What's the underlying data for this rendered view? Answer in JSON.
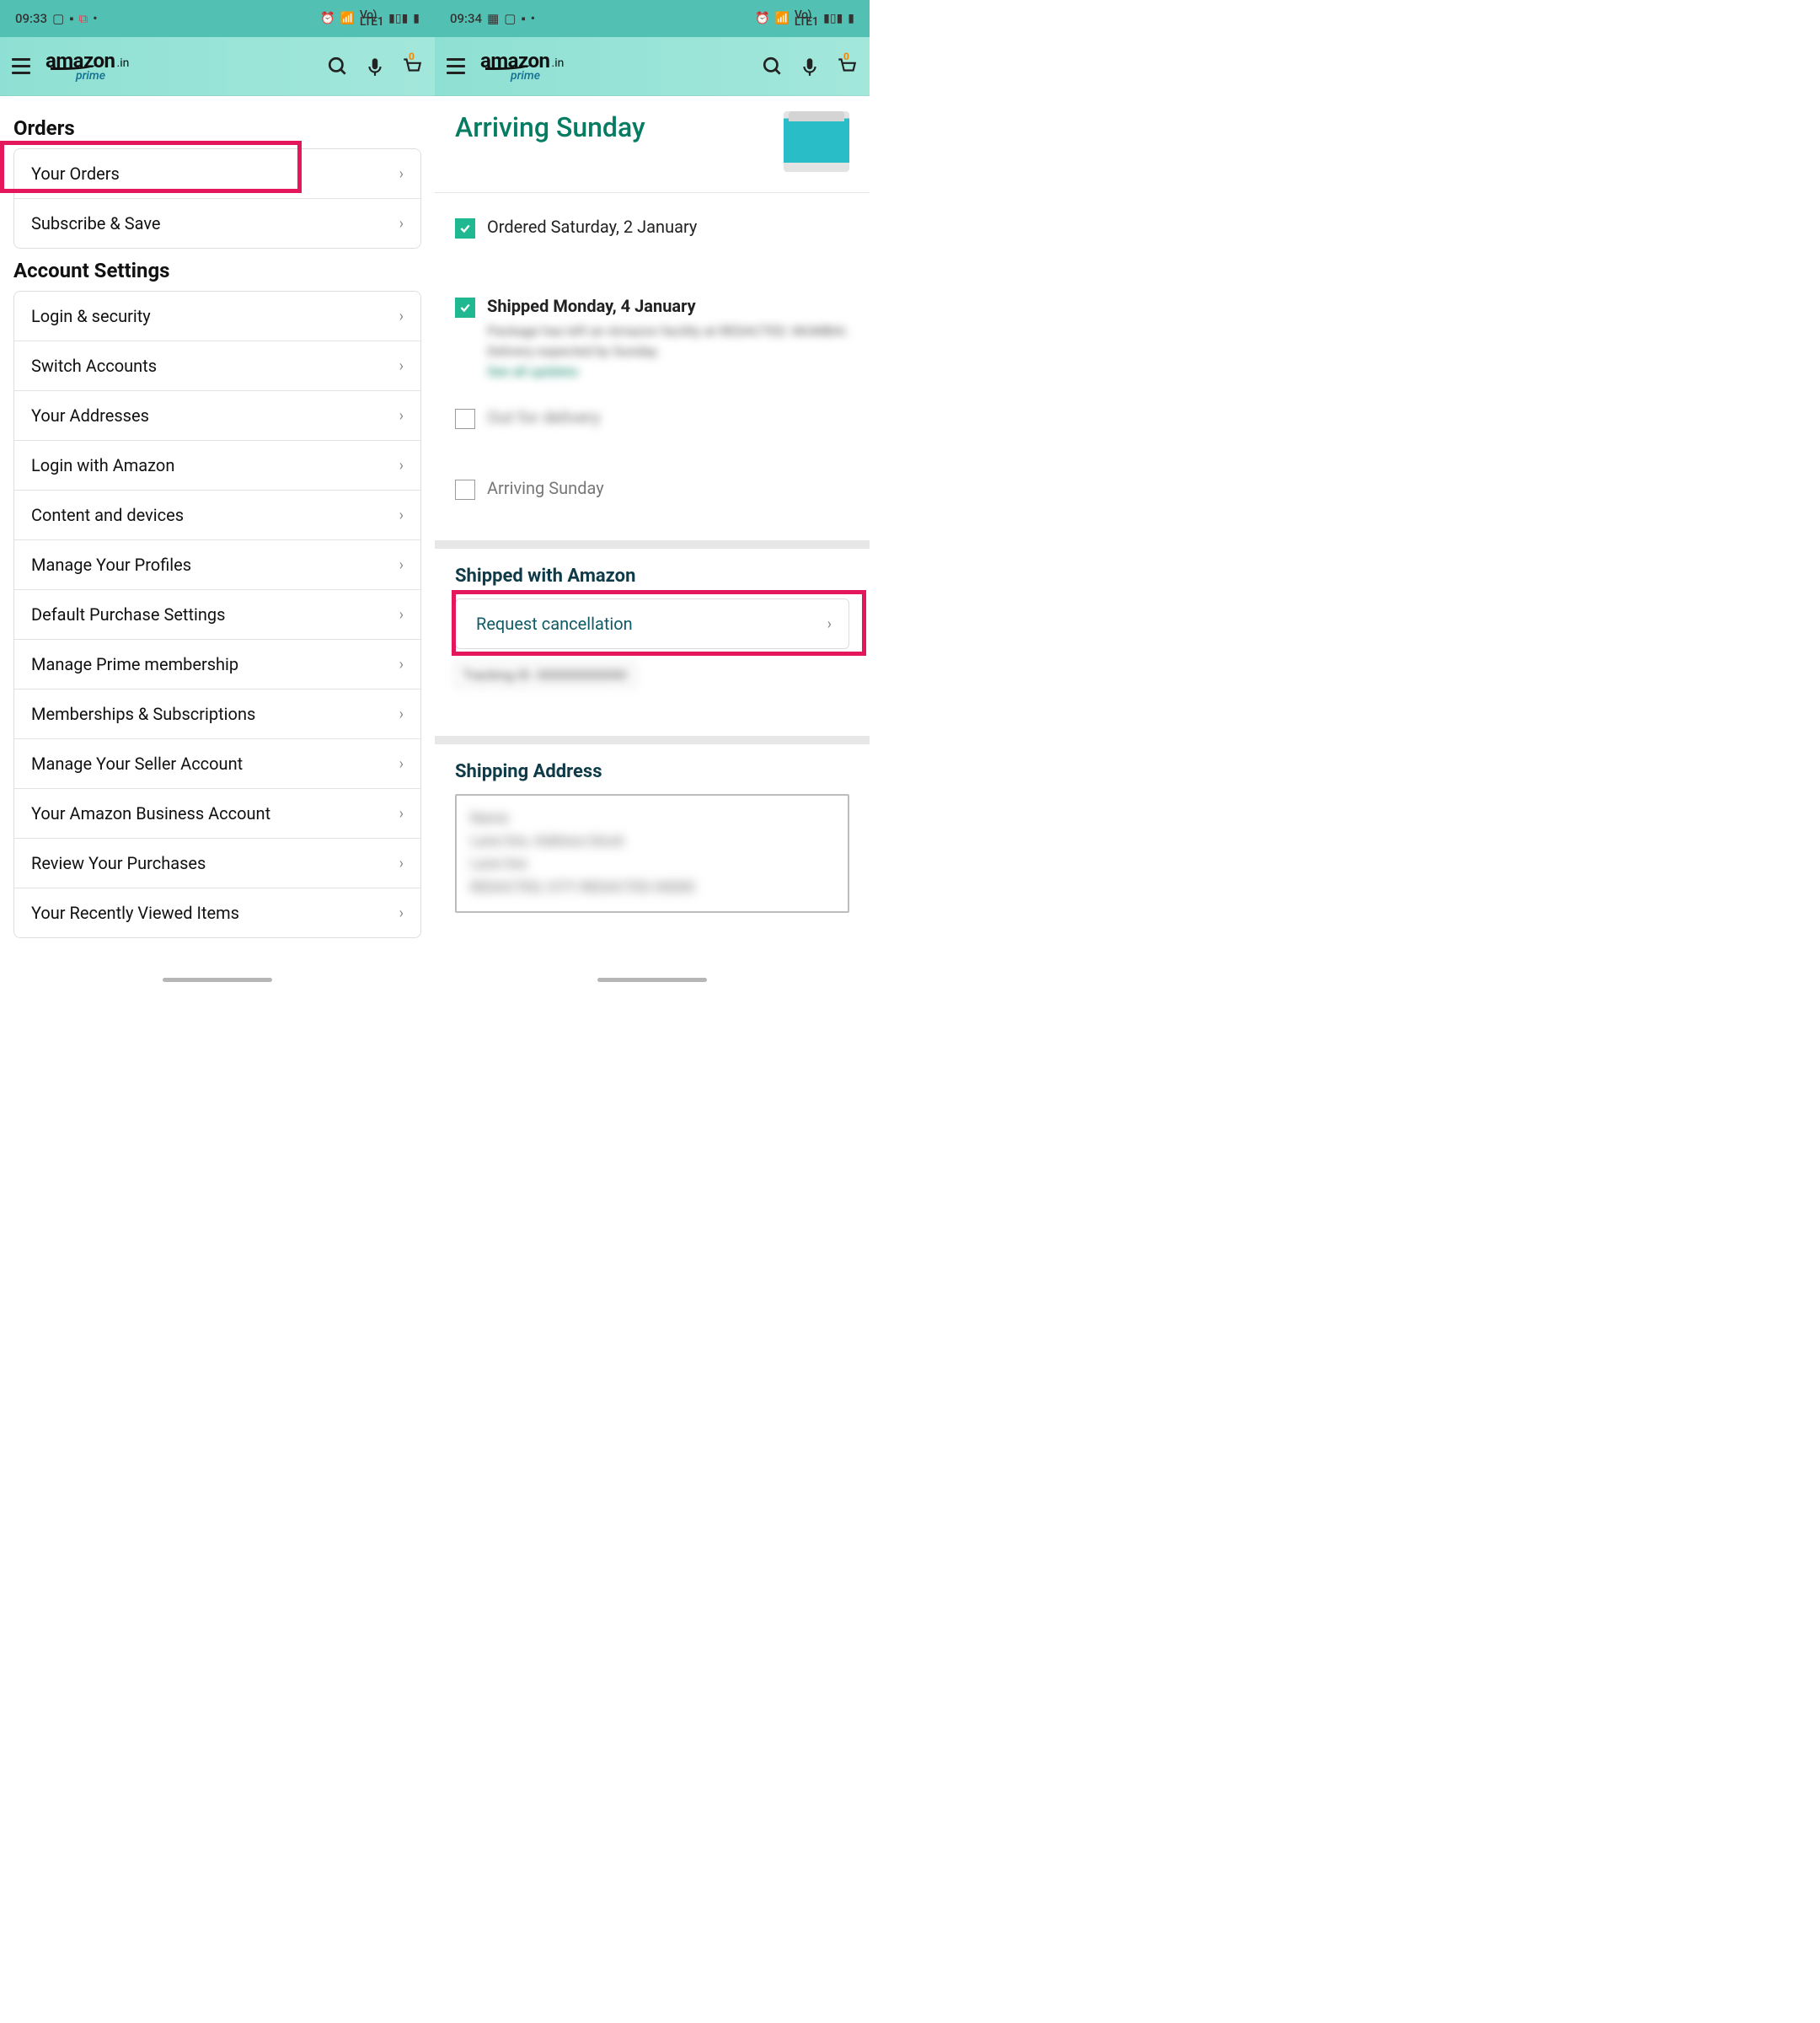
{
  "left": {
    "time": "09:33",
    "status_icons": [
      "image-icon",
      "bag-icon",
      "misc-icon",
      "dot"
    ],
    "right_icons": [
      "alarm",
      "wifi",
      "volte",
      "signal",
      "battery"
    ],
    "brand": {
      "name": "amazon",
      "domain": ".in",
      "sub": "prime"
    },
    "cart_count": "0",
    "sections": {
      "orders": {
        "title": "Orders",
        "items": [
          "Your Orders",
          "Subscribe & Save"
        ]
      },
      "account": {
        "title": "Account Settings",
        "items": [
          "Login & security",
          "Switch Accounts",
          "Your Addresses",
          "Login with Amazon",
          "Content and devices",
          "Manage Your Profiles",
          "Default Purchase Settings",
          "Manage Prime membership",
          "Memberships & Subscriptions",
          "Manage Your Seller Account",
          "Your Amazon Business Account",
          "Review Your Purchases",
          "Your Recently Viewed Items"
        ]
      }
    }
  },
  "right": {
    "time": "09:34",
    "status_icons": [
      "grid-icon",
      "image-icon",
      "bag-icon",
      "dot"
    ],
    "brand": {
      "name": "amazon",
      "domain": ".in",
      "sub": "prime"
    },
    "cart_count": "0",
    "arriving": "Arriving Sunday",
    "timeline": {
      "ordered": "Ordered Saturday, 2 January",
      "shipped": "Shipped Monday, 4 January",
      "shipped_sub": "Package has left an Amazon facility at REDACTED. MUMBAI. Delivery expected by Sunday.",
      "see_updates": "See all updates",
      "out": "Out for delivery",
      "arriving": "Arriving Sunday"
    },
    "shipped_with": "Shipped with Amazon",
    "request": "Request cancellation",
    "tracking": "Tracking ID: 000000000000",
    "shipping_addr_title": "Shipping Address",
    "addr": [
      "Name",
      "Lane line, Address block",
      "Lane line",
      "REDACTED, CITY REDACTED 00000"
    ]
  }
}
